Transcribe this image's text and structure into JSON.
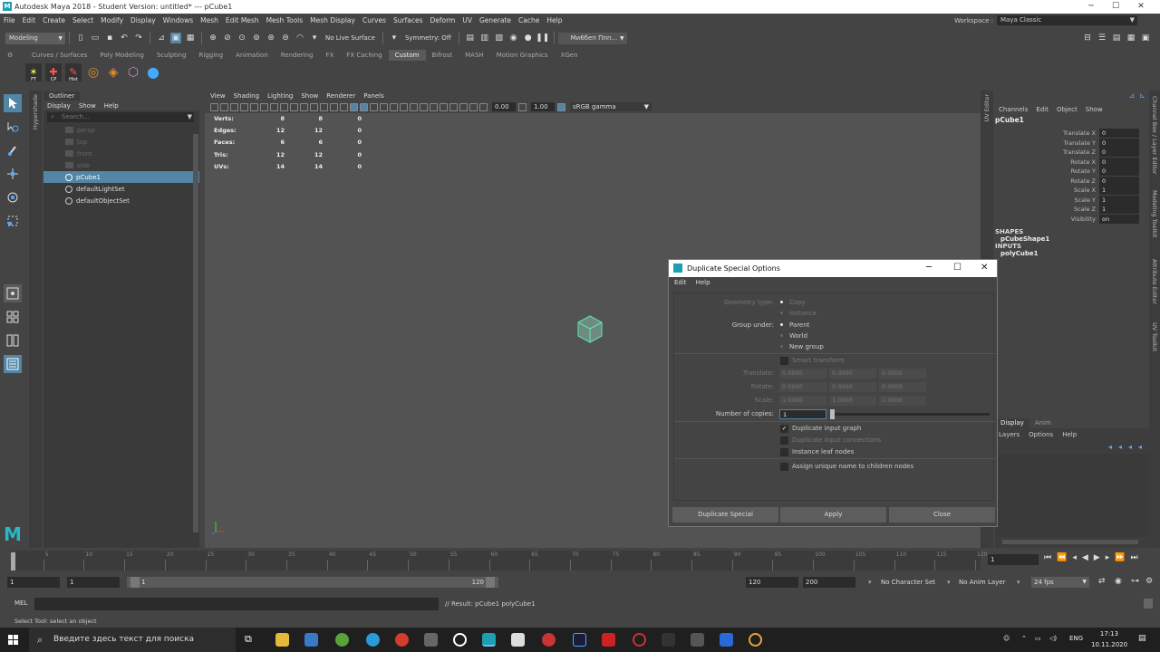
{
  "window": {
    "title": "Autodesk Maya 2018 - Student Version: untitled*   ---   pCube1",
    "controls": {
      "minimize": "─",
      "maximize": "☐",
      "close": "✕"
    }
  },
  "menubar": {
    "items": [
      "File",
      "Edit",
      "Create",
      "Select",
      "Modify",
      "Display",
      "Windows",
      "Mesh",
      "Edit Mesh",
      "Mesh Tools",
      "Mesh Display",
      "Curves",
      "Surfaces",
      "Deform",
      "UV",
      "Generate",
      "Cache",
      "Help"
    ],
    "workspace_label": "Workspace :",
    "workspace_value": "Maya Classic"
  },
  "statusline": {
    "mode": "Modeling",
    "live_surface": "No Live Surface",
    "symmetry": "Symmetry: Off",
    "user": "Ми6беп Ппп..."
  },
  "shelf": {
    "tabs": [
      "Curves / Surfaces",
      "Poly Modeling",
      "Sculpting",
      "Rigging",
      "Animation",
      "Rendering",
      "FX",
      "FX Caching",
      "Custom",
      "Bifrost",
      "MASH",
      "Motion Graphics",
      "XGen"
    ],
    "active_tab": "Custom",
    "buttons": [
      "FT",
      "CP",
      "Hist"
    ]
  },
  "outliner": {
    "tab": "Outliner",
    "menu": [
      "Display",
      "Show",
      "Help"
    ],
    "search_placeholder": "Search...",
    "side_tab": "Hypershade",
    "items": [
      {
        "label": "persp",
        "dim": true
      },
      {
        "label": "top",
        "dim": true
      },
      {
        "label": "front",
        "dim": true
      },
      {
        "label": "side",
        "dim": true
      },
      {
        "label": "pCube1",
        "selected": true
      },
      {
        "label": "defaultLightSet"
      },
      {
        "label": "defaultObjectSet"
      }
    ]
  },
  "viewport": {
    "menu": [
      "View",
      "Shading",
      "Lighting",
      "Show",
      "Renderer",
      "Panels"
    ],
    "exposure": "0.00",
    "gamma": "1.00",
    "colorspace": "sRGB gamma",
    "hud": [
      {
        "label": "Verts:",
        "a": "8",
        "b": "8",
        "c": "0"
      },
      {
        "label": "Edges:",
        "a": "12",
        "b": "12",
        "c": "0"
      },
      {
        "label": "Faces:",
        "a": "6",
        "b": "6",
        "c": "0"
      },
      {
        "label": "Tris:",
        "a": "12",
        "b": "12",
        "c": "0"
      },
      {
        "label": "UVs:",
        "a": "14",
        "b": "14",
        "c": "0"
      }
    ],
    "camera": "persp"
  },
  "side_tabs": {
    "uv": "UV Editor",
    "right": [
      "Channel Box / Layer Editor",
      "Modeling Toolkit",
      "Attribute Editor",
      "UV Toolkit"
    ]
  },
  "channelbox": {
    "menu": [
      "Channels",
      "Edit",
      "Object",
      "Show"
    ],
    "object": "pCube1",
    "attributes": [
      {
        "label": "Translate X",
        "value": "0"
      },
      {
        "label": "Translate Y",
        "value": "0"
      },
      {
        "label": "Translate Z",
        "value": "0"
      },
      {
        "label": "Rotate X",
        "value": "0"
      },
      {
        "label": "Rotate Y",
        "value": "0"
      },
      {
        "label": "Rotate Z",
        "value": "0"
      },
      {
        "label": "Scale X",
        "value": "1"
      },
      {
        "label": "Scale Y",
        "value": "1"
      },
      {
        "label": "Scale Z",
        "value": "1"
      },
      {
        "label": "Visibility",
        "value": "on"
      }
    ],
    "shapes_header": "SHAPES",
    "shape": "pCubeShape1",
    "inputs_header": "INPUTS",
    "input": "polyCube1",
    "layer_tabs": [
      "Display",
      "Anim"
    ],
    "layer_menu": [
      "Layers",
      "Options",
      "Help"
    ]
  },
  "dialog": {
    "title": "Duplicate Special Options",
    "menu": [
      "Edit",
      "Help"
    ],
    "geometry_type_label": "Geometry type:",
    "geometry_options": [
      "Copy",
      "Instance"
    ],
    "group_under_label": "Group under:",
    "group_options": [
      "Parent",
      "World",
      "New group"
    ],
    "smart_transform": "Smart transform",
    "translate_label": "Translate:",
    "rotate_label": "Rotate:",
    "scale_label": "Scale:",
    "translate": [
      "0.0000",
      "0.0000",
      "0.0000"
    ],
    "rotate": [
      "0.0000",
      "0.0000",
      "0.0000"
    ],
    "scale": [
      "1.0000",
      "1.0000",
      "1.0000"
    ],
    "copies_label": "Number of copies:",
    "copies_value": "1",
    "copies_slider_fraction": 0.0,
    "dup_input_graph": "Duplicate input graph",
    "dup_input_connections": "Duplicate input connections",
    "instance_leaf": "Instance leaf nodes",
    "assign_unique": "Assign unique name to children nodes",
    "buttons": [
      "Duplicate Special",
      "Apply",
      "Close"
    ]
  },
  "timeslider": {
    "ticks": [
      "1",
      "5",
      "10",
      "15",
      "20",
      "25",
      "30",
      "35",
      "40",
      "45",
      "50",
      "55",
      "60",
      "65",
      "70",
      "75",
      "80",
      "85",
      "90",
      "95",
      "100",
      "105",
      "110",
      "115",
      "120"
    ],
    "current_frame": "1"
  },
  "rangeslider": {
    "start": "1",
    "inner_start": "1",
    "range_start": "1",
    "range_end": "120",
    "end": "120",
    "anim_end": "200",
    "char_set": "No Character Set",
    "anim_layer": "No Anim Layer",
    "fps": "24 fps"
  },
  "command": {
    "lang": "MEL",
    "result": "// Result: pCube1 polyCube1"
  },
  "helpline": "Select Tool: select an object",
  "taskbar": {
    "search_placeholder": "Введите здесь текст для поиска",
    "lang": "ENG",
    "time": "17:13",
    "date": "10.11.2020"
  }
}
